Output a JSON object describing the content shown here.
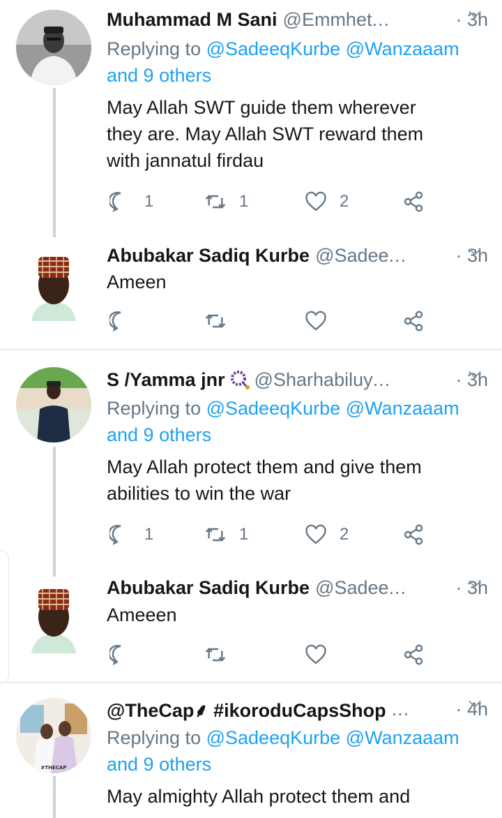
{
  "tweets": [
    {
      "name": "Muhammad M Sani",
      "handle": "@Emmhet",
      "time": "3h",
      "replying_label": "Replying to",
      "mentions": "@SadeeqKurbe @Wanzaaam",
      "others": "and 9 others",
      "text_lines": [
        "May Allah SWT guide them wherever",
        "they are. May Allah SWT reward them",
        "with jannatul firdau"
      ],
      "replies": "1",
      "retweets": "1",
      "likes": "2"
    },
    {
      "name": "Abubakar Sadiq Kurbe",
      "handle": "@Sadee",
      "time": "3h",
      "text_lines": [
        "Ameen"
      ],
      "replies": "",
      "retweets": "",
      "likes": ""
    },
    {
      "name": "S /Yamma jnr",
      "handle": "@Sharhabiluy",
      "time": "3h",
      "replying_label": "Replying to",
      "mentions": "@SadeeqKurbe @Wanzaaam",
      "others": "and 9 others",
      "text_lines": [
        "May Allah protect them and give them",
        "abilities to win the war"
      ],
      "replies": "1",
      "retweets": "1",
      "likes": "2"
    },
    {
      "name": "Abubakar Sadiq Kurbe",
      "handle": "@Sadee",
      "time": "3h",
      "text_lines": [
        "Ameeen"
      ],
      "replies": "",
      "retweets": "",
      "likes": ""
    },
    {
      "name": "@TheCap⸙ #ikoroduCapsShop",
      "handle": "",
      "time": "4h",
      "replying_label": "Replying to",
      "mentions": "@SadeeqKurbe @Wanzaaam",
      "others": "and 9 others",
      "text_lines": [
        "May almighty Allah protect them and"
      ],
      "avatar_caption": "#THECAP"
    }
  ],
  "ellipsis": "...",
  "time_sep": "·",
  "icons": [
    "reply-icon",
    "retweet-icon",
    "like-icon",
    "share-icon",
    "chevron-down-icon",
    "prayer-beads-icon"
  ],
  "colors": {
    "link": "#1da1f2",
    "muted": "#657786",
    "text": "#14171a",
    "thread": "#c9d3dc",
    "divider": "#e6ecf0"
  }
}
